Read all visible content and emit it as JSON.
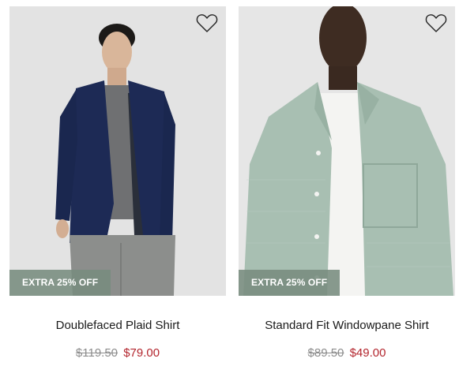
{
  "products": [
    {
      "name": "Doublefaced Plaid Shirt",
      "badge": "EXTRA 25% OFF",
      "original_price": "$119.50",
      "sale_price": "$79.00",
      "icon": "heart-outline-icon"
    },
    {
      "name": "Standard Fit Windowpane Shirt",
      "badge": "EXTRA 25% OFF",
      "original_price": "$89.50",
      "sale_price": "$49.00",
      "icon": "heart-outline-icon"
    }
  ],
  "colors": {
    "badge_bg": "#788c7e",
    "sale_price": "#b3262e",
    "original_price": "#8c8c8c"
  }
}
